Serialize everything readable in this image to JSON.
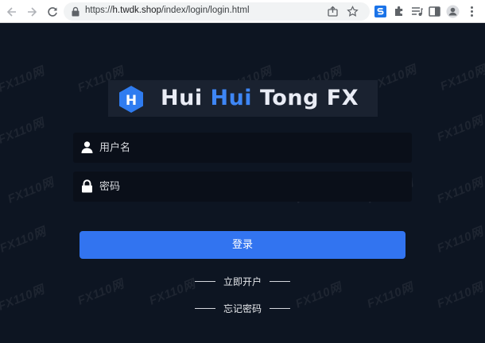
{
  "browser": {
    "url_scheme": "https://",
    "url_host": "h.twdk.shop",
    "url_path": "/index/login/login.html",
    "icons": [
      "back-icon",
      "forward-icon",
      "reload-icon",
      "lock-icon",
      "share-icon",
      "bookmark-star-icon",
      "extension-s-icon",
      "puzzle-extensions-icon",
      "media-queue-icon",
      "side-panel-icon",
      "profile-icon",
      "kebab-menu-icon"
    ]
  },
  "brand": {
    "logo_letter": "H",
    "name_part1": "Hui ",
    "name_part2": "Hui",
    "name_part3": " Tong FX",
    "accent_color": "#3e86f5"
  },
  "form": {
    "username_placeholder": "用户名",
    "username_value": "",
    "password_placeholder": "密码",
    "password_value": "",
    "login_label": "登录"
  },
  "links": {
    "open_account": "立即开户",
    "forgot_password": "忘记密码"
  },
  "watermark": {
    "text": "FX110网"
  },
  "colors": {
    "page_bg": "#0d1522",
    "input_bg": "#0a0f19",
    "button_bg": "#3274f0"
  }
}
